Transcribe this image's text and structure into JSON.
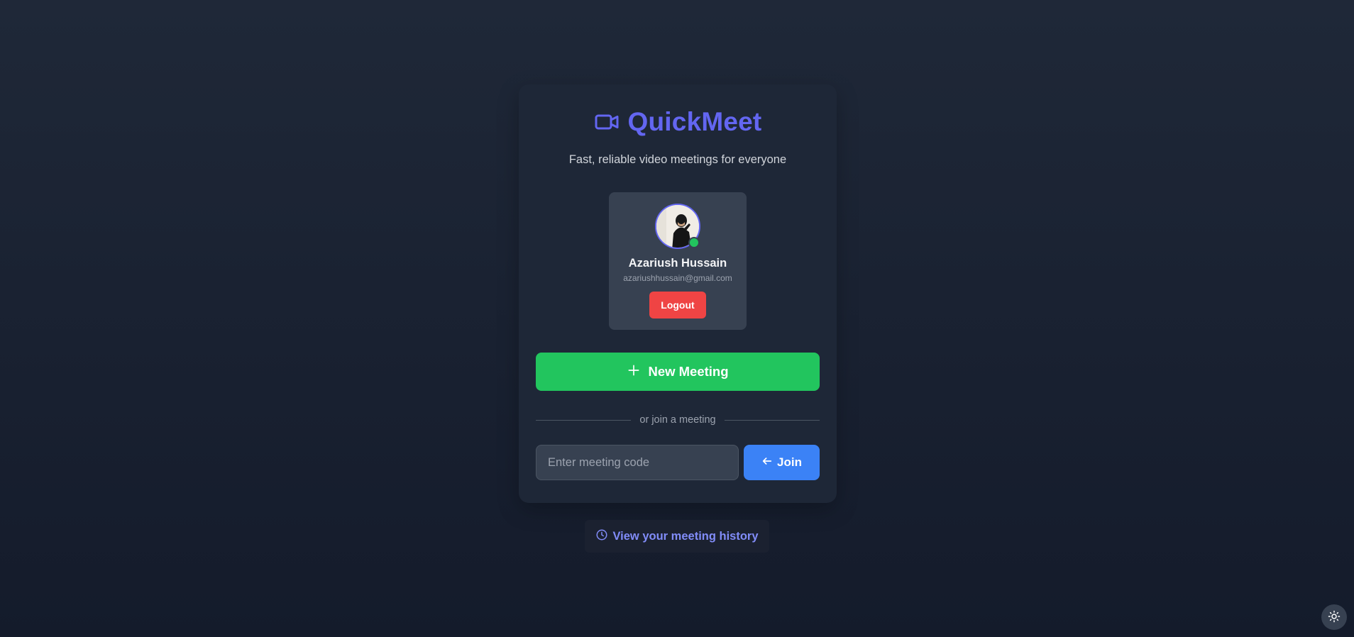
{
  "brand": {
    "title": "QuickMeet",
    "tagline": "Fast, reliable video meetings for everyone",
    "icon": "video-camera-icon",
    "accent_color": "#6366f1"
  },
  "user": {
    "name": "Azariush Hussain",
    "email": "azariushhussain@gmail.com",
    "status": "online",
    "status_color": "#22c55e",
    "logout_label": "Logout"
  },
  "actions": {
    "new_meeting_label": "New Meeting",
    "new_meeting_icon": "plus-icon",
    "divider_text": "or join a meeting",
    "code_placeholder": "Enter meeting code",
    "code_value": "",
    "join_label": "Join",
    "join_icon": "arrow-left-icon"
  },
  "footer": {
    "history_label": "View your meeting history",
    "history_icon": "clock-icon",
    "theme_toggle_icon": "sun-icon"
  },
  "colors": {
    "success": "#22c55e",
    "danger": "#ef4444",
    "primary": "#3b82f6",
    "link": "#818cf8"
  }
}
